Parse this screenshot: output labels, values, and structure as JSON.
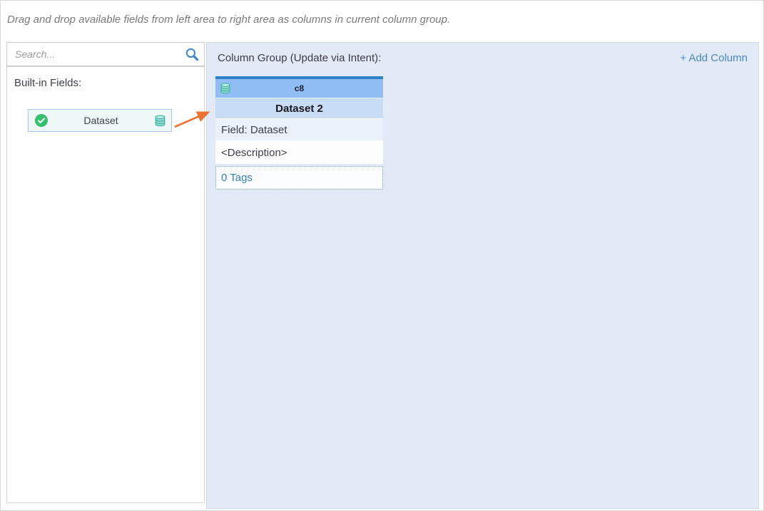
{
  "instruction": "Drag and drop available fields from left area to right area as columns in current column group.",
  "left_panel": {
    "search": {
      "placeholder": "Search...",
      "icon": "search-icon"
    },
    "section_title": "Built-in Fields:",
    "fields": [
      {
        "label": "Dataset",
        "selected": true,
        "left_icon": "check-circle-icon",
        "right_icon": "database-icon"
      }
    ]
  },
  "right_panel": {
    "title": "Column Group (Update via Intent):",
    "add_column_label": "+ Add Column",
    "cards": [
      {
        "header_icon": "database-icon",
        "code": "c8",
        "title": "Dataset 2",
        "field_label": "Field: Dataset",
        "description_placeholder": "<Description>",
        "tags_label": "0 Tags"
      }
    ]
  },
  "colors": {
    "accent_blue": "#3f87c9",
    "link_blue": "#4a87ca",
    "panel_background": "#e3eaf7",
    "card_topbar": "#2f7fc4",
    "card_header_bg": "#90bdf4",
    "card_title_bg": "#c9dcf6",
    "card_field_bg": "#eaf1fb",
    "tags_text": "#3a7cc1",
    "arrow_orange": "#ed7134",
    "check_green": "#35c06d",
    "database_teal": "#7fd6ca",
    "field_item_bg": "#eef9f7"
  }
}
